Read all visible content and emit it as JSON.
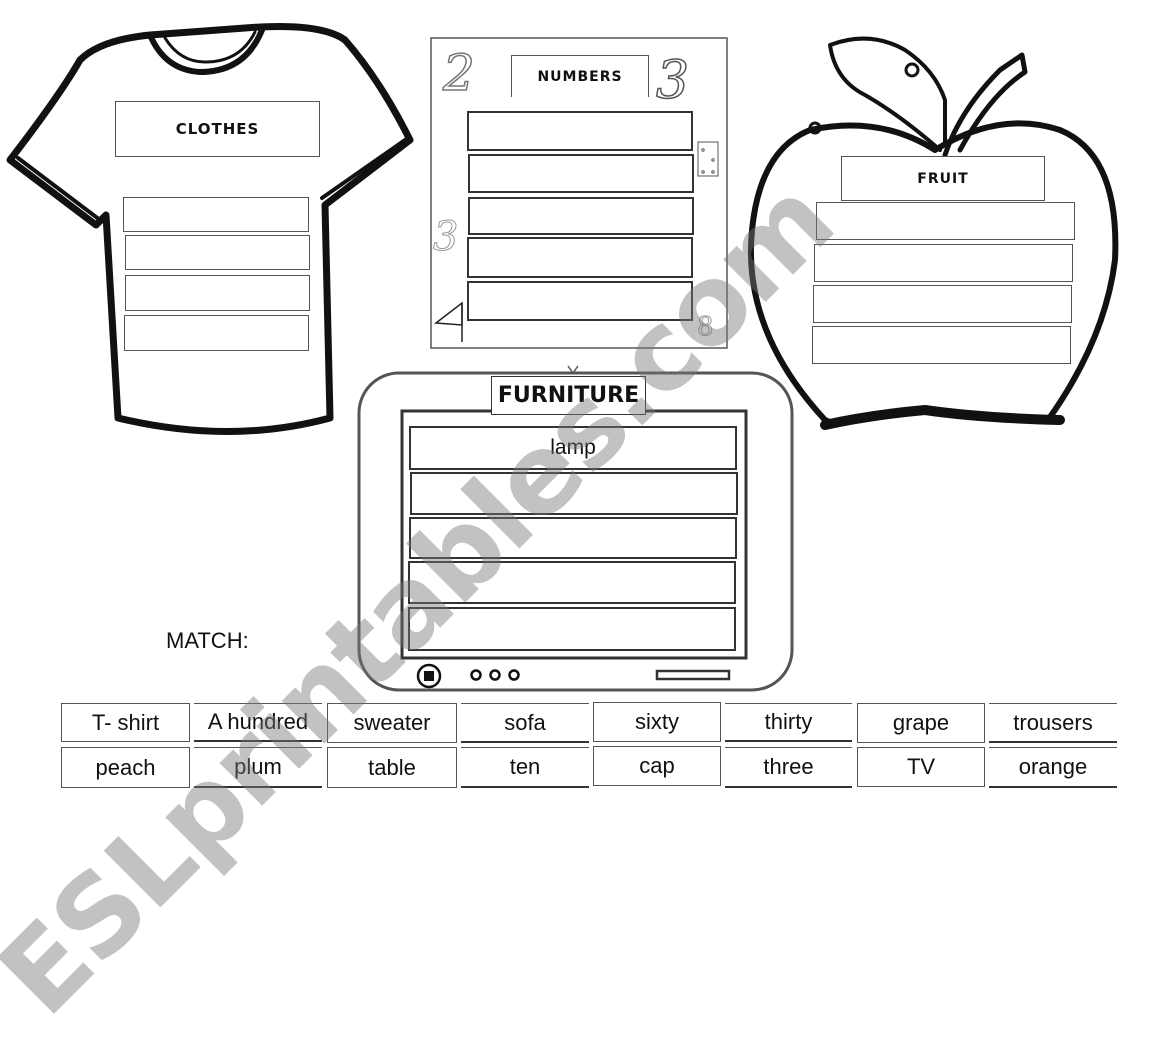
{
  "worksheet": {
    "categories": {
      "clothes": {
        "title": "CLOTHES",
        "slots": [
          "",
          "",
          "",
          ""
        ]
      },
      "numbers": {
        "title": "NUMBERS",
        "slots": [
          "",
          "",
          "",
          "",
          ""
        ]
      },
      "fruit": {
        "title": "FRUIT",
        "slots": [
          "",
          "",
          "",
          ""
        ]
      },
      "furniture": {
        "title": "FURNITURE",
        "slots": [
          "lamp",
          "",
          "",
          "",
          ""
        ]
      }
    },
    "match_label": "MATCH:",
    "word_bank": {
      "row1": [
        "T- shirt",
        "A hundred",
        "sweater",
        "sofa",
        "sixty",
        "thirty",
        "grape",
        "trousers"
      ],
      "row2": [
        "peach",
        "plum",
        "table",
        "ten",
        "cap",
        "three",
        "TV",
        "orange"
      ]
    },
    "watermark": "ESLprintables.com",
    "decorations": {
      "numbers_card": [
        "digit-2-icon",
        "digit-3-icon",
        "dice-icon",
        "digit-3-small-icon",
        "ruler-triangle-icon",
        "digit-8-icon"
      ],
      "tv": [
        "power-button-icon",
        "tv-knobs-icon",
        "tv-slot-icon",
        "antenna-icon"
      ]
    }
  }
}
